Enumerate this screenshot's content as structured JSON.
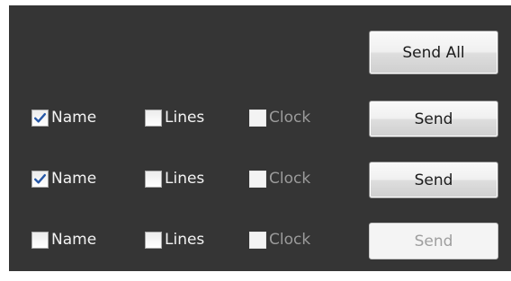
{
  "send_all_label": "Send All",
  "rows": [
    {
      "name": {
        "label": "Name",
        "checked": true,
        "enabled": true
      },
      "lines": {
        "label": "Lines",
        "checked": false,
        "enabled": true
      },
      "clock": {
        "label": "Clock",
        "checked": false,
        "enabled": false
      },
      "send_label": "Send",
      "send_enabled": true
    },
    {
      "name": {
        "label": "Name",
        "checked": true,
        "enabled": true
      },
      "lines": {
        "label": "Lines",
        "checked": false,
        "enabled": true
      },
      "clock": {
        "label": "Clock",
        "checked": false,
        "enabled": false
      },
      "send_label": "Send",
      "send_enabled": true
    },
    {
      "name": {
        "label": "Name",
        "checked": false,
        "enabled": true
      },
      "lines": {
        "label": "Lines",
        "checked": false,
        "enabled": true
      },
      "clock": {
        "label": "Clock",
        "checked": false,
        "enabled": false
      },
      "send_label": "Send",
      "send_enabled": false
    }
  ],
  "colors": {
    "panel_background": "#353535",
    "checkmark": "#2557a7",
    "text": "#f3f3f3",
    "disabled_text": "#9b9b9b"
  },
  "icons": {
    "checked": "checkmark-icon"
  }
}
